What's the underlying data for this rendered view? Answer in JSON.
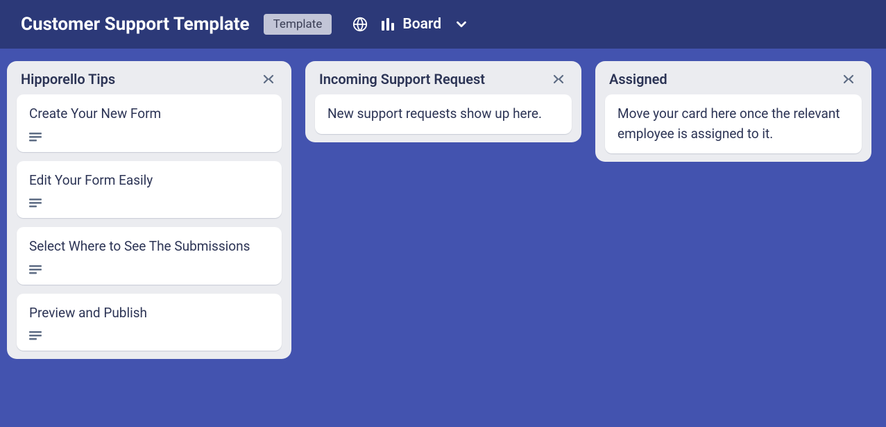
{
  "header": {
    "title": "Customer Support Template",
    "badge": "Template",
    "view_label": "Board"
  },
  "lists": [
    {
      "title": "Hipporello Tips",
      "cards": [
        {
          "title": "Create Your New Form",
          "has_description": true
        },
        {
          "title": "Edit Your Form Easily",
          "has_description": true
        },
        {
          "title": "Select Where to See The Submissions",
          "has_description": true
        },
        {
          "title": "Preview and Publish",
          "has_description": true
        }
      ],
      "scrollable": true
    },
    {
      "title": "Incoming Support Request",
      "cards": [
        {
          "title": "New support requests show up here.",
          "has_description": false
        }
      ],
      "scrollable": false
    },
    {
      "title": "Assigned",
      "cards": [
        {
          "title": "Move your card here once the relevant employee is assigned to it.",
          "has_description": false
        }
      ],
      "scrollable": false
    }
  ]
}
